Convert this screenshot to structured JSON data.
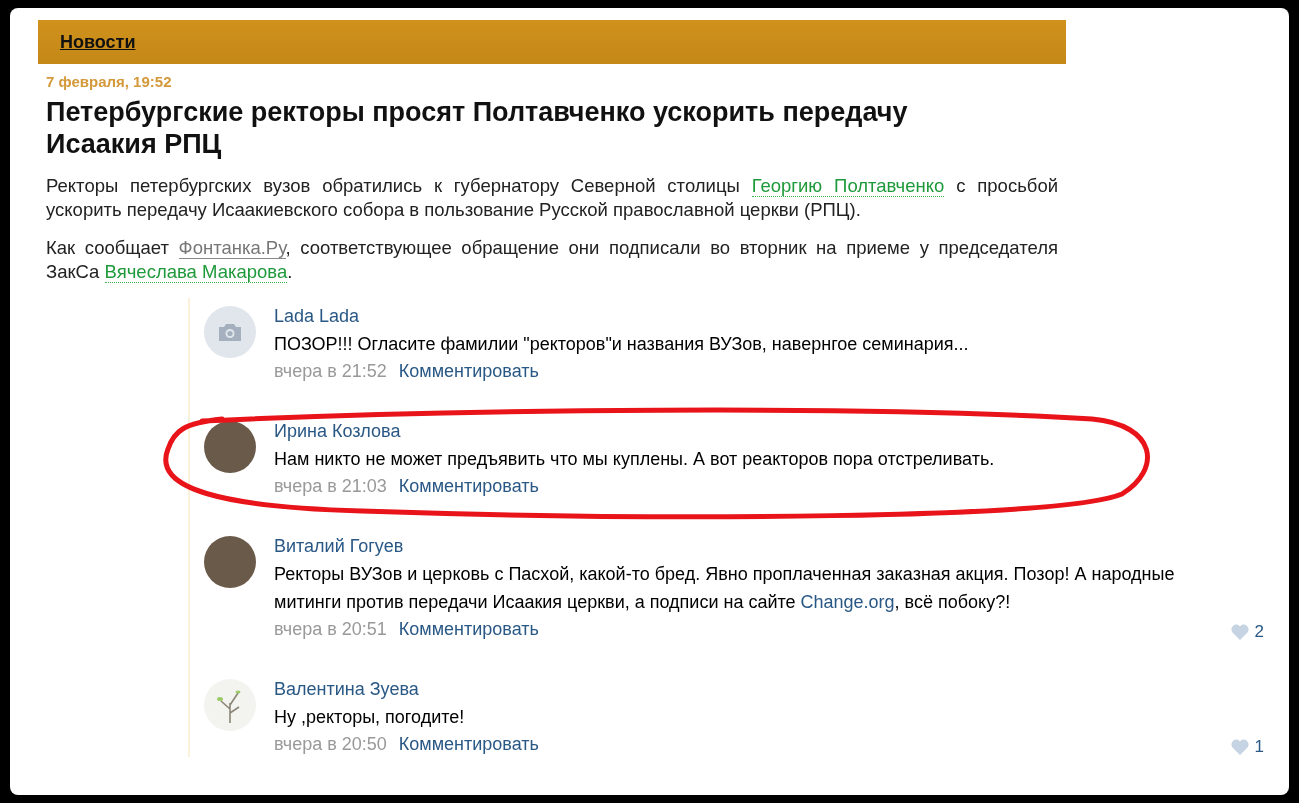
{
  "section": {
    "title": "Новости"
  },
  "article": {
    "date": "7 февраля, 19:52",
    "title": "Петербургские ректоры просят Полтавченко ускорить передачу Исаакия  РПЦ",
    "paragraphs": [
      [
        {
          "kind": "text",
          "text": "Ректоры петербургских вузов обратились к губернатору Северной столицы "
        },
        {
          "kind": "person",
          "text": "Георгию Полтавченко"
        },
        {
          "kind": "text",
          "text": " с просьбой ускорить передачу Исаакиевского собора в пользование Русской православной церкви (РПЦ)."
        }
      ],
      [
        {
          "kind": "text",
          "text": "Как сообщает "
        },
        {
          "kind": "source",
          "text": "Фонтанка.Ру"
        },
        {
          "kind": "text",
          "text": ", соответствующее обращение они подписали во вторник на приеме у председателя ЗакСа "
        },
        {
          "kind": "person",
          "text": "Вячеслава Макарова"
        },
        {
          "kind": "text",
          "text": "."
        }
      ]
    ]
  },
  "comments": [
    {
      "author": "Lada Lada",
      "kind": "camera",
      "highlighted": false,
      "text": [
        {
          "kind": "text",
          "text": "ПОЗОР!!! Огласите фамилии \"ректоров\"и названия ВУЗов, навернгое семинария..."
        }
      ],
      "time": "вчера в 21:52",
      "action": "Комментировать"
    },
    {
      "author": "Ирина Козлова",
      "kind": "photo",
      "highlighted": true,
      "text": [
        {
          "kind": "text",
          "text": "Нам никто не может предъявить что мы куплены. А вот реакторов пора отстреливать."
        }
      ],
      "time": "вчера в 21:03",
      "action": "Комментировать"
    },
    {
      "author": "Виталий Гогуев",
      "kind": "photo",
      "highlighted": false,
      "text": [
        {
          "kind": "text",
          "text": "Ректоры ВУЗов и церковь с Пасхой, какой-то бред. Явно проплаченная заказная акция. Позор! А народные митинги против передачи Исаакия церкви, а подписи на сайте "
        },
        {
          "kind": "link",
          "text": "Change.org"
        },
        {
          "kind": "text",
          "text": ", всё побоку?!"
        }
      ],
      "time": "вчера в 20:51",
      "action": "Комментировать",
      "likes": "2"
    },
    {
      "author": "Валентина Зуева",
      "kind": "plant",
      "highlighted": false,
      "text": [
        {
          "kind": "text",
          "text": "Ну ,ректоры, погодите!"
        }
      ],
      "time": "вчера в 20:50",
      "action": "Комментировать",
      "likes": "1"
    }
  ]
}
